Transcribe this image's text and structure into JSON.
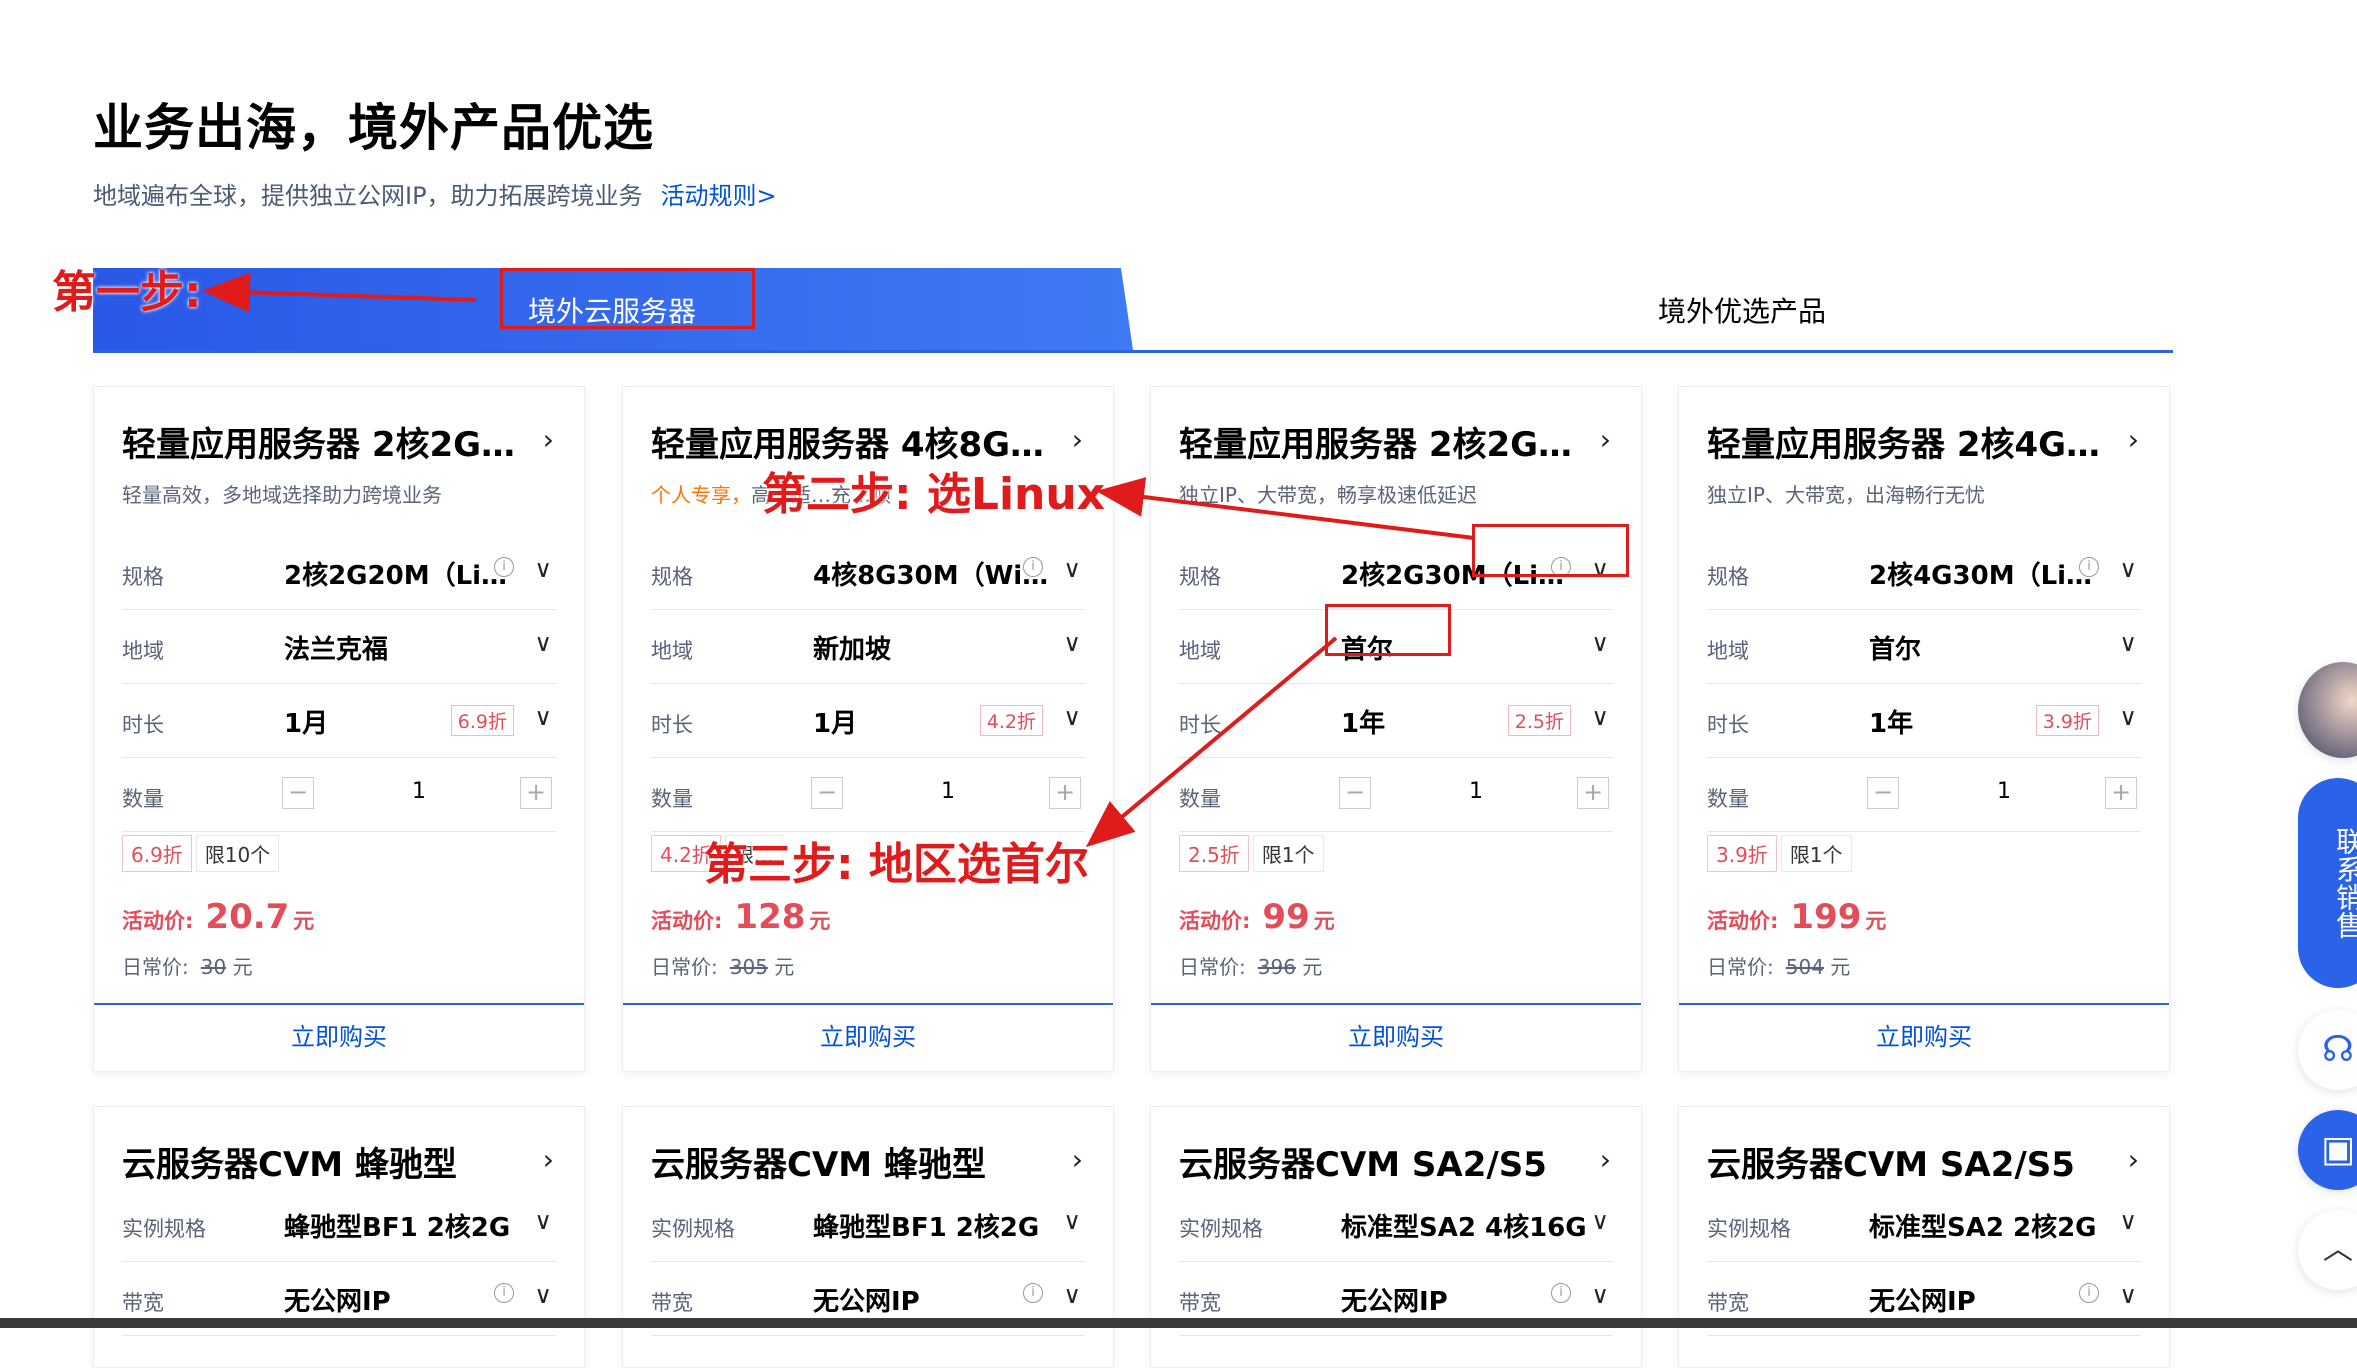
{
  "hero": {
    "title": "业务出海，境外产品优选",
    "subtitle": "地域遍布全球，提供独立公网IP，助力拓展跨境业务",
    "rules_link": "活动规则>"
  },
  "tabs": [
    {
      "label": "境外云服务器",
      "active": true
    },
    {
      "label": "境外优选产品",
      "active": false
    }
  ],
  "cards": [
    {
      "title": "轻量应用服务器 2核2G…",
      "desc_hl": "",
      "desc": "轻量高效，多地域选择助力跨境业务",
      "rows": [
        {
          "label": "规格",
          "value": "2核2G20M（Li…",
          "info": true
        },
        {
          "label": "地域",
          "value": "法兰克福"
        },
        {
          "label": "时长",
          "value": "1月",
          "discount": "6.9折"
        },
        {
          "label": "数量",
          "qty": "1"
        }
      ],
      "tags": [
        "6.9折",
        "限10个"
      ],
      "price_label": "活动价:",
      "price": "20.7",
      "unit": "元",
      "orig_label": "日常价:",
      "orig": "30",
      "orig_unit": "元",
      "buy": "立即购买"
    },
    {
      "title": "轻量应用服务器 4核8G…",
      "desc_hl": "个人专享，",
      "desc": "高…适…充…顾",
      "rows": [
        {
          "label": "规格",
          "value": "4核8G30M（Wi…",
          "info": true
        },
        {
          "label": "地域",
          "value": "新加坡"
        },
        {
          "label": "时长",
          "value": "1月",
          "discount": "4.2折"
        },
        {
          "label": "数量",
          "qty": "1"
        }
      ],
      "tags": [
        "4.2折",
        "限…"
      ],
      "price_label": "活动价:",
      "price": "128",
      "unit": "元",
      "orig_label": "日常价:",
      "orig": "305",
      "orig_unit": "元",
      "buy": "立即购买"
    },
    {
      "title": "轻量应用服务器 2核2G…",
      "desc_hl": "",
      "desc": "独立IP、大带宽，畅享极速低延迟",
      "rows": [
        {
          "label": "规格",
          "value": "2核2G30M（Li…",
          "info": true
        },
        {
          "label": "地域",
          "value": "首尔"
        },
        {
          "label": "时长",
          "value": "1年",
          "discount": "2.5折"
        },
        {
          "label": "数量",
          "qty": "1"
        }
      ],
      "tags": [
        "2.5折",
        "限1个"
      ],
      "price_label": "活动价:",
      "price": "99",
      "unit": "元",
      "orig_label": "日常价:",
      "orig": "396",
      "orig_unit": "元",
      "buy": "立即购买"
    },
    {
      "title": "轻量应用服务器 2核4G…",
      "desc_hl": "",
      "desc": "独立IP、大带宽，出海畅行无忧",
      "rows": [
        {
          "label": "规格",
          "value": "2核4G30M（Li…",
          "info": true
        },
        {
          "label": "地域",
          "value": "首尔"
        },
        {
          "label": "时长",
          "value": "1年",
          "discount": "3.9折"
        },
        {
          "label": "数量",
          "qty": "1"
        }
      ],
      "tags": [
        "3.9折",
        "限1个"
      ],
      "price_label": "活动价:",
      "price": "199",
      "unit": "元",
      "orig_label": "日常价:",
      "orig": "504",
      "orig_unit": "元",
      "buy": "立即购买"
    }
  ],
  "cards2": [
    {
      "title": "云服务器CVM 蜂驰型",
      "spec_label": "实例规格",
      "spec": "蜂驰型BF1 2核2G",
      "bw_label": "带宽",
      "bw": "无公网IP"
    },
    {
      "title": "云服务器CVM 蜂驰型",
      "spec_label": "实例规格",
      "spec": "蜂驰型BF1 2核2G",
      "bw_label": "带宽",
      "bw": "无公网IP"
    },
    {
      "title": "云服务器CVM SA2/S5",
      "spec_label": "实例规格",
      "spec": "标准型SA2 4核16G",
      "bw_label": "带宽",
      "bw": "无公网IP"
    },
    {
      "title": "云服务器CVM SA2/S5",
      "spec_label": "实例规格",
      "spec": "标准型SA2 2核2G",
      "bw_label": "带宽",
      "bw": "无公网IP"
    }
  ],
  "annotations": {
    "step1": "第一步:",
    "step2": "第二步: 选Linux",
    "step3": "第三步: 地区选首尔"
  },
  "sidebar": {
    "contact": "联系销售"
  },
  "colors": {
    "accent": "#0052d9",
    "tab": "#2958e6",
    "price": "#e34d59",
    "annotation": "#e01b1b"
  }
}
